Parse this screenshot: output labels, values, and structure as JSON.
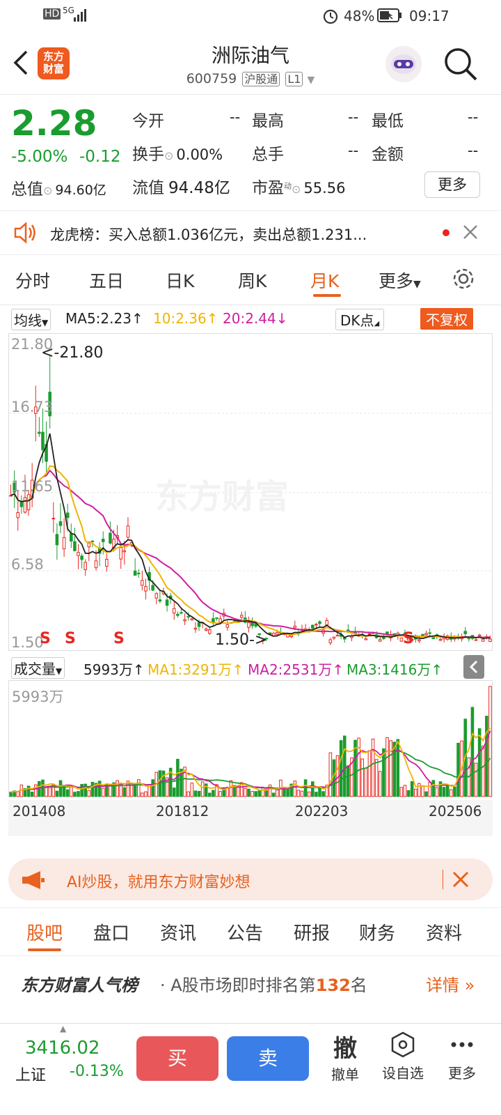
{
  "status": {
    "signal": "5G",
    "battery": "48%",
    "time": "09:17",
    "hd": "HD"
  },
  "header": {
    "logo_line1": "东方",
    "logo_line2": "财富",
    "title": "洲际油气",
    "code": "600759",
    "tag1": "沪股通",
    "tag2": "L1"
  },
  "quote": {
    "price": "2.28",
    "pct": "-5.00%",
    "chg": "-0.12",
    "open_l": "今开",
    "open_v": "--",
    "high_l": "最高",
    "high_v": "--",
    "low_l": "最低",
    "low_v": "--",
    "turn_l": "换手",
    "turn_v": "0.00%",
    "vol_l": "总手",
    "vol_v": "--",
    "amt_l": "金额",
    "amt_v": "--",
    "mcap_l": "总值",
    "mcap_v": "94.60亿",
    "float_l": "流值",
    "float_v": "94.48亿",
    "pe_l": "市盈",
    "pe_sup": "动",
    "pe_v": "55.56",
    "more": "更多"
  },
  "notice": {
    "text": "龙虎榜：买入总额1.036亿元，卖出总额1.231..."
  },
  "tabs": [
    "分时",
    "五日",
    "日K",
    "周K",
    "月K",
    "更多"
  ],
  "ma": {
    "type": "均线",
    "ma5": "MA5:2.23",
    "ma10": "10:2.36",
    "ma20": "20:2.44",
    "dk": "DK点",
    "fq": "不复权",
    "ma5_arrow": "↑",
    "ma10_arrow": "↑",
    "ma20_arrow": "↓"
  },
  "kline": {
    "y_labels": [
      "21.80",
      "16.73",
      "11.65",
      "6.58",
      "1.50"
    ],
    "max_label": "<-21.80",
    "min_label": "1.50->",
    "watermark": "东方财富",
    "marks": [
      "S",
      "S",
      "S",
      "S"
    ]
  },
  "vol": {
    "type": "成交量",
    "value": "5993万",
    "ma1": "MA1:3291万",
    "ma2": "MA2:2531万",
    "ma3": "MA3:1416万",
    "arrow": "↑",
    "top_label": "5993万"
  },
  "dates": [
    "201408",
    "201812",
    "202203",
    "202506"
  ],
  "ad": {
    "text": "AI炒股，就用东方财富妙想"
  },
  "bottom_tabs": [
    "股吧",
    "盘口",
    "资讯",
    "公告",
    "研报",
    "财务",
    "资料"
  ],
  "rank": {
    "brand": "东方财富人气榜",
    "text_pre": "· A股市场即时排名第",
    "num": "132",
    "text_post": "名",
    "link": "详情"
  },
  "footer": {
    "index_val": "3416.02",
    "index_name": "上证",
    "index_pct": "-0.13%",
    "buy": "买",
    "sell": "卖",
    "cancel_icon": "撤",
    "cancel": "撤单",
    "watch": "设自选",
    "more": "更多"
  },
  "colors": {
    "up": "#e8261e",
    "down": "#1a9c2e",
    "accent": "#ee5a1f",
    "ma5": "#222222",
    "ma10": "#f0b400",
    "ma20": "#cc1fa0",
    "sell": "#3b7ee8"
  }
}
